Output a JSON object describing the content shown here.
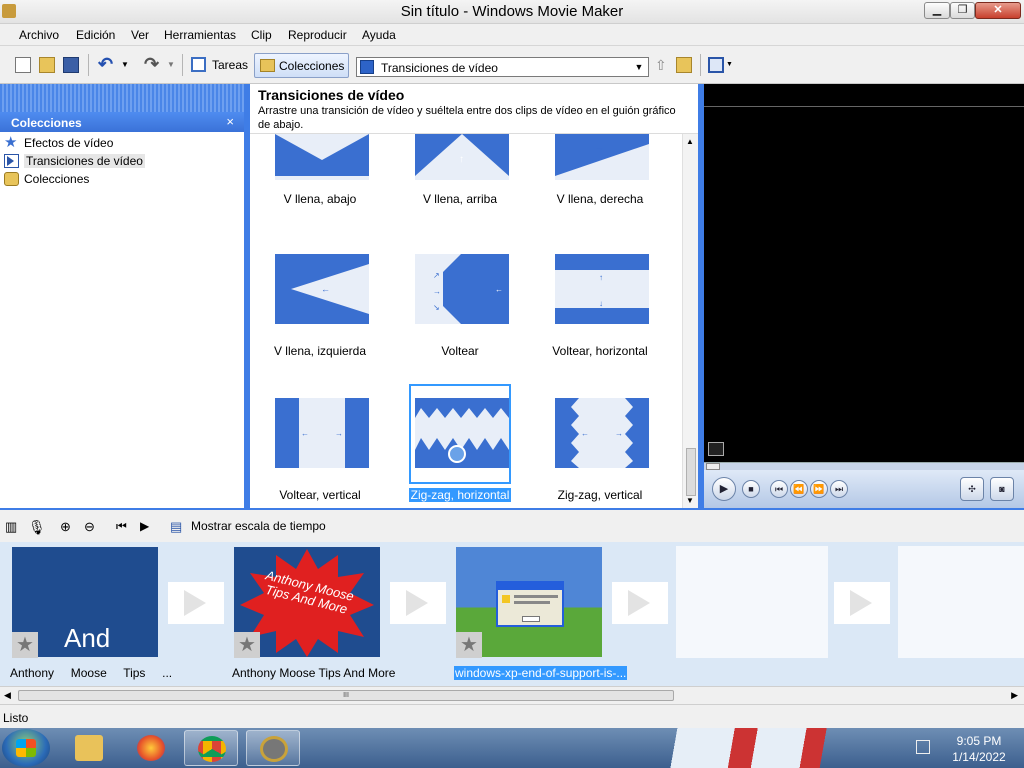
{
  "window": {
    "title": "Sin título - Windows Movie Maker",
    "minimize_icon": "minimize-icon",
    "maximize_icon": "restore-icon",
    "close_label": "✕"
  },
  "menu": [
    "Archivo",
    "Edición",
    "Ver",
    "Herramientas",
    "Clip",
    "Reproducir",
    "Ayuda"
  ],
  "toolbar": {
    "tasks_label": "Tareas",
    "collections_label": "Colecciones",
    "collection_select_value": "Transiciones de vídeo"
  },
  "left_panel": {
    "header": "Colecciones",
    "close_label": "×",
    "items": [
      "Efectos de vídeo",
      "Transiciones de vídeo",
      "Colecciones"
    ]
  },
  "center": {
    "title": "Transiciones de vídeo",
    "description": "Arrastre una transición de vídeo y suéltela entre dos clips de vídeo en el guión gráfico de abajo.",
    "tiles": [
      {
        "label": "V llena, abajo"
      },
      {
        "label": "V llena, arriba"
      },
      {
        "label": "V llena, derecha"
      },
      {
        "label": "V llena, izquierda"
      },
      {
        "label": "Voltear"
      },
      {
        "label": "Voltear, horizontal"
      },
      {
        "label": "Voltear, vertical"
      },
      {
        "label": "Zig-zag, horizontal",
        "selected": true
      },
      {
        "label": "Zig-zag, vertical"
      }
    ]
  },
  "storyboard_bar": {
    "timeline_label": "Mostrar escala de tiempo"
  },
  "storyboard": {
    "clips": [
      {
        "caption_words": [
          "Anthony",
          "Moose",
          "Tips",
          "..."
        ],
        "overlay_text": "And"
      },
      {
        "caption": "Anthony Moose Tips And More",
        "overlay_text": "Anthony Moose Tips And More"
      },
      {
        "caption": "windows-xp-end-of-support-is-...",
        "selected": true
      }
    ]
  },
  "hscroll": {
    "grip": "III"
  },
  "status": {
    "text": "Listo"
  },
  "taskbar": {
    "time": "9:05 PM",
    "date": "1/14/2022"
  },
  "colors": {
    "accent_blue": "#3f7de6",
    "tile_blue": "#3a6fd0",
    "selection": "#3399ff"
  }
}
